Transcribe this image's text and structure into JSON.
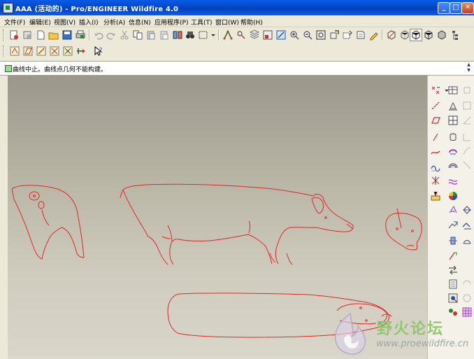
{
  "window": {
    "title": "AAA (活动的) - Pro/ENGINEER Wildfire 4.0",
    "minimize": "_",
    "maximize": "□",
    "close": "✕"
  },
  "menu": [
    "文件(F)",
    "编辑(E)",
    "视图(V)",
    "插入(I)",
    "分析(A)",
    "信息(N)",
    "应用程序(P)",
    "工具(T)",
    "窗口(W)",
    "帮助(H)"
  ],
  "message": {
    "text": "曲线中止。曲线点几何不能构建。",
    "icon": "message-info-icon"
  },
  "toolbar_row1_icons": [
    "new-icon",
    "open-icon",
    "save-icon",
    "copy-icon",
    "print-icon",
    "email-icon",
    "save-copy-icon",
    "undo-icon",
    "redo-icon",
    "cut-icon",
    "copy-clip-icon",
    "paste-icon",
    "paste-special-icon",
    "regenerate-icon",
    "find-icon",
    "select-box-icon",
    "spin-center-icon",
    "datum-display-icon",
    "layer-icon",
    "view-manager-icon",
    "repaint-icon",
    "zoom-in-icon",
    "zoom-out-icon",
    "refit-icon",
    "reorient-icon",
    "saved-views-icon",
    "named-view-icon",
    "wireframe-icon",
    "hidden-line-icon",
    "no-hidden-icon",
    "shading-icon",
    "model-tree-icon"
  ],
  "toolbar_row2_icons": [
    "datum-plane-icon",
    "datum-axis-icon",
    "datum-curve-icon",
    "datum-point-icon",
    "coord-sys-icon",
    "analysis-icon",
    "whats-this-icon"
  ],
  "right_col1_icons": [
    "datum-point-tool-icon",
    "datum-axis-tool-icon",
    "datum-plane-tool-icon",
    "sketch-curve-icon",
    "datum-curve-tool-icon",
    "style-icon",
    "analysis-feature-icon",
    "warp-icon"
  ],
  "right_col2_icons": [
    "table-icon",
    "extrude-icon",
    "pattern-icon",
    "revolve-icon",
    "sweep-icon",
    "blend-icon",
    "hole-icon",
    "round-icon",
    "shell-icon",
    "rib-icon",
    "draft-icon",
    "chamfer-icon",
    "mirror-icon",
    "merge-icon",
    "trim-icon",
    "offset-icon",
    "thicken-icon",
    "solidify-icon",
    "intersect-icon",
    "project-icon",
    "wrap-icon"
  ],
  "watermark": {
    "name": "野火论坛",
    "url": "www.proewildfire.cn",
    "logo": "flame-logo-icon"
  },
  "colors": {
    "sketch_curve": "#e02828",
    "title_bar": "#0a5ce6",
    "chrome": "#ece9d8"
  }
}
